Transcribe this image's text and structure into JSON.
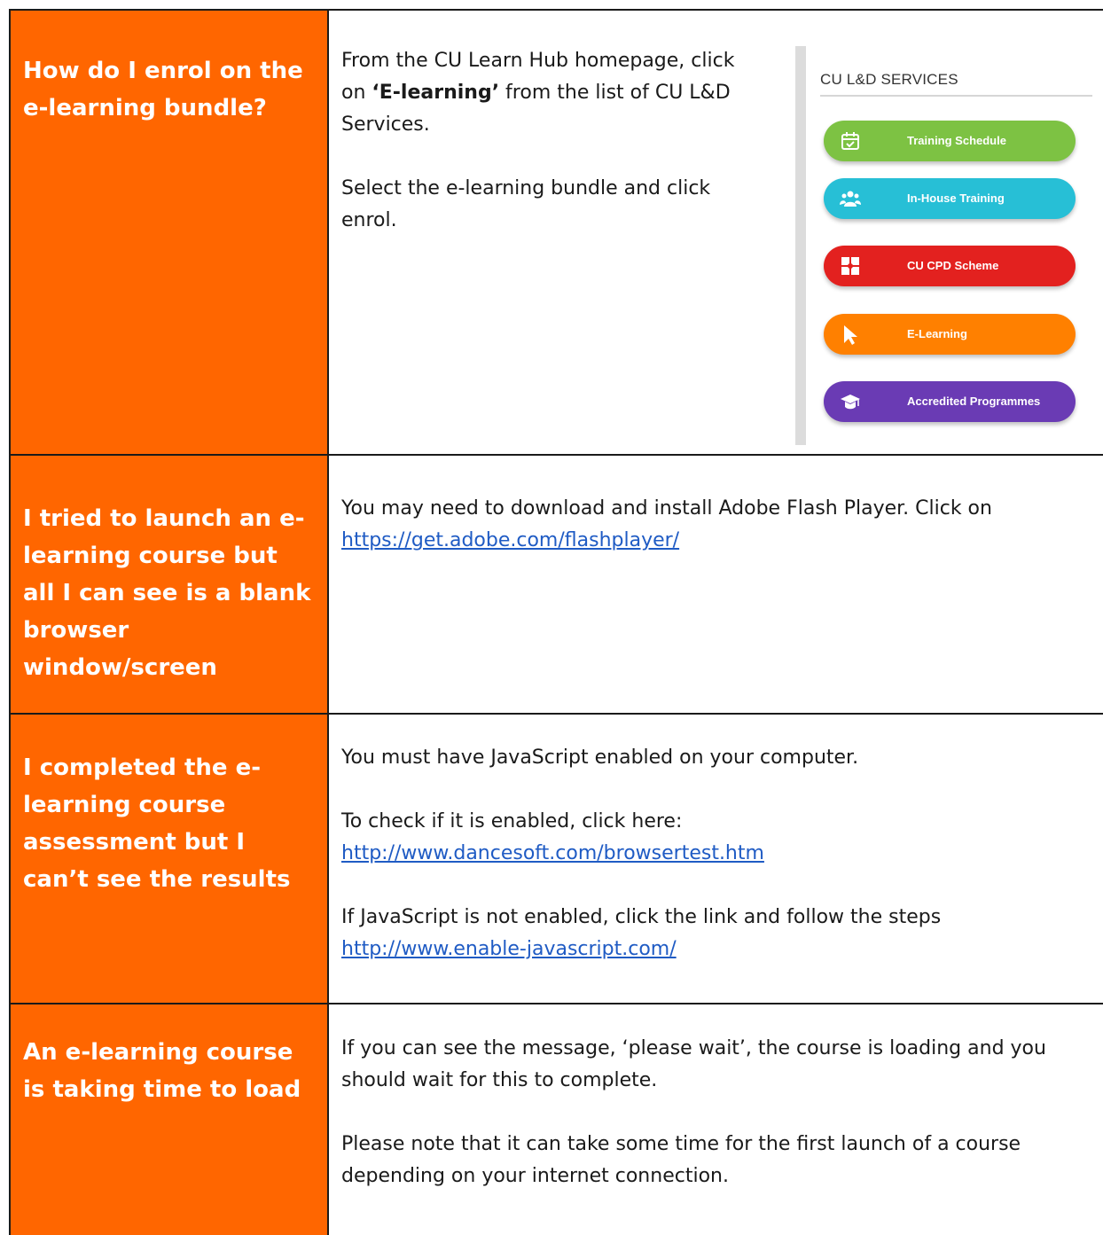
{
  "faq": [
    {
      "question": "How do I enrol on the e-learning bundle?",
      "answer_p1_before": "From the CU Learn Hub homepage, click on ",
      "answer_p1_bold": "‘E-learning’",
      "answer_p1_after": " from the list of CU L&D Services.",
      "answer_p2": "Select the e-learning bundle and click enrol."
    },
    {
      "question": "I tried to launch an e-learning course but all I can see is a blank browser window/screen",
      "answer_text": "You may need to download and install Adobe Flash Player.  Click on ",
      "answer_link": "https://get.adobe.com/flashplayer/"
    },
    {
      "question": "I completed the e-learning course assessment but I can’t see the results",
      "answer_p1": "You must have JavaScript enabled on your computer.",
      "answer_p2_text": "To check if it is enabled, click here: ",
      "answer_p2_link": "http://www.dancesoft.com/browsertest.htm",
      "answer_p3_text": "If JavaScript is not enabled, click the link and follow the steps ",
      "answer_p3_link": "http://www.enable-javascript.com/"
    },
    {
      "question": "An e-learning course is taking time to load",
      "answer_p1": "If you can see the message, ‘please wait’, the course is loading and you should wait for this to complete.",
      "answer_p2": "Please note that it can take some time for the first launch of a course depending on your internet connection."
    }
  ],
  "services_panel": {
    "title": "CU L&D SERVICES",
    "items": [
      {
        "label": "Training Schedule",
        "color": "#7dc243",
        "icon": "calendar-check-icon"
      },
      {
        "label": "In-House Training",
        "color": "#27bfd6",
        "icon": "people-group-icon"
      },
      {
        "label": "CU CPD Scheme",
        "color": "#e3211f",
        "icon": "puzzle-icon"
      },
      {
        "label": "E-Learning",
        "color": "#ff8000",
        "icon": "cursor-pointer-icon"
      },
      {
        "label": "Accredited Programmes",
        "color": "#6a3bb4",
        "icon": "graduation-cap-icon"
      }
    ]
  },
  "colors": {
    "question_bg": "#ff6600",
    "link": "#1f5bc4"
  }
}
